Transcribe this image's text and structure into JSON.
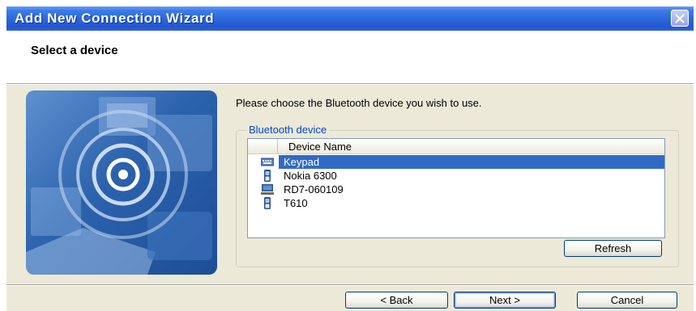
{
  "window": {
    "title": "Add New Connection Wizard"
  },
  "header": {
    "title": "Select a device"
  },
  "main": {
    "prompt": "Please choose the Bluetooth device you wish to use.",
    "group_label": "Bluetooth device",
    "column_header": "Device Name",
    "devices": [
      {
        "name": "Keypad",
        "icon": "keyboard-icon",
        "selected": true
      },
      {
        "name": "Nokia 6300",
        "icon": "phone-icon",
        "selected": false
      },
      {
        "name": "RD7-060109",
        "icon": "computer-icon",
        "selected": false
      },
      {
        "name": "T610",
        "icon": "phone-icon",
        "selected": false
      }
    ],
    "refresh_label": "Refresh"
  },
  "footer": {
    "back_label": "< Back",
    "next_label": "Next >",
    "cancel_label": "Cancel"
  },
  "colors": {
    "titlebar": "#2a66dc",
    "selection": "#316ac5",
    "group_label": "#0046d5",
    "dialog_bg": "#ece9d8"
  }
}
